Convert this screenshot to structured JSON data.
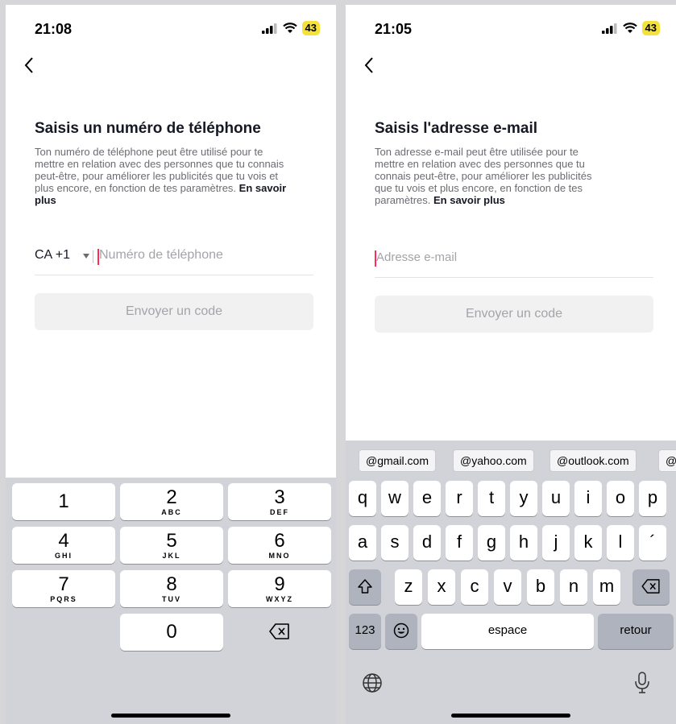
{
  "phone_screen": {
    "status": {
      "time": "21:08",
      "battery": "43"
    },
    "title": "Saisis un numéro de téléphone",
    "description": [
      "Ton numéro de téléphone peut être utilisé pour te",
      "mettre en relation avec des personnes que tu connais",
      "peut-être, pour améliorer les publicités que tu vois et",
      "plus encore, en fonction de tes paramètres."
    ],
    "learn_more_1": "En savoir",
    "learn_more_2": "plus",
    "country_code": "CA +1",
    "phone_placeholder": "Numéro de téléphone",
    "send_button": "Envoyer un code",
    "numpad": [
      {
        "digit": "1",
        "letters": ""
      },
      {
        "digit": "2",
        "letters": "ABC"
      },
      {
        "digit": "3",
        "letters": "DEF"
      },
      {
        "digit": "4",
        "letters": "GHI"
      },
      {
        "digit": "5",
        "letters": "JKL"
      },
      {
        "digit": "6",
        "letters": "MNO"
      },
      {
        "digit": "7",
        "letters": "PQRS"
      },
      {
        "digit": "8",
        "letters": "TUV"
      },
      {
        "digit": "9",
        "letters": "WXYZ"
      },
      {
        "digit": "0",
        "letters": ""
      }
    ]
  },
  "email_screen": {
    "status": {
      "time": "21:05",
      "battery": "43"
    },
    "title": "Saisis l'adresse e-mail",
    "description": [
      "Ton adresse e-mail peut être utilisée pour te",
      "mettre en relation avec des personnes que tu",
      "connais peut-être, pour améliorer les publicités",
      "que tu vois et plus encore, en fonction de tes",
      "paramètres."
    ],
    "learn_more": "En savoir plus",
    "email_placeholder": "Adresse e-mail",
    "send_button": "Envoyer un code",
    "suggestions": [
      "@gmail.com",
      "@yahoo.com",
      "@outlook.com",
      "@"
    ],
    "row1": [
      "q",
      "w",
      "e",
      "r",
      "t",
      "y",
      "u",
      "i",
      "o",
      "p"
    ],
    "row2": [
      "a",
      "s",
      "d",
      "f",
      "g",
      "h",
      "j",
      "k",
      "l",
      "´"
    ],
    "row3": [
      "z",
      "x",
      "c",
      "v",
      "b",
      "n",
      "m"
    ],
    "key_123": "123",
    "key_space": "espace",
    "key_return": "retour"
  }
}
